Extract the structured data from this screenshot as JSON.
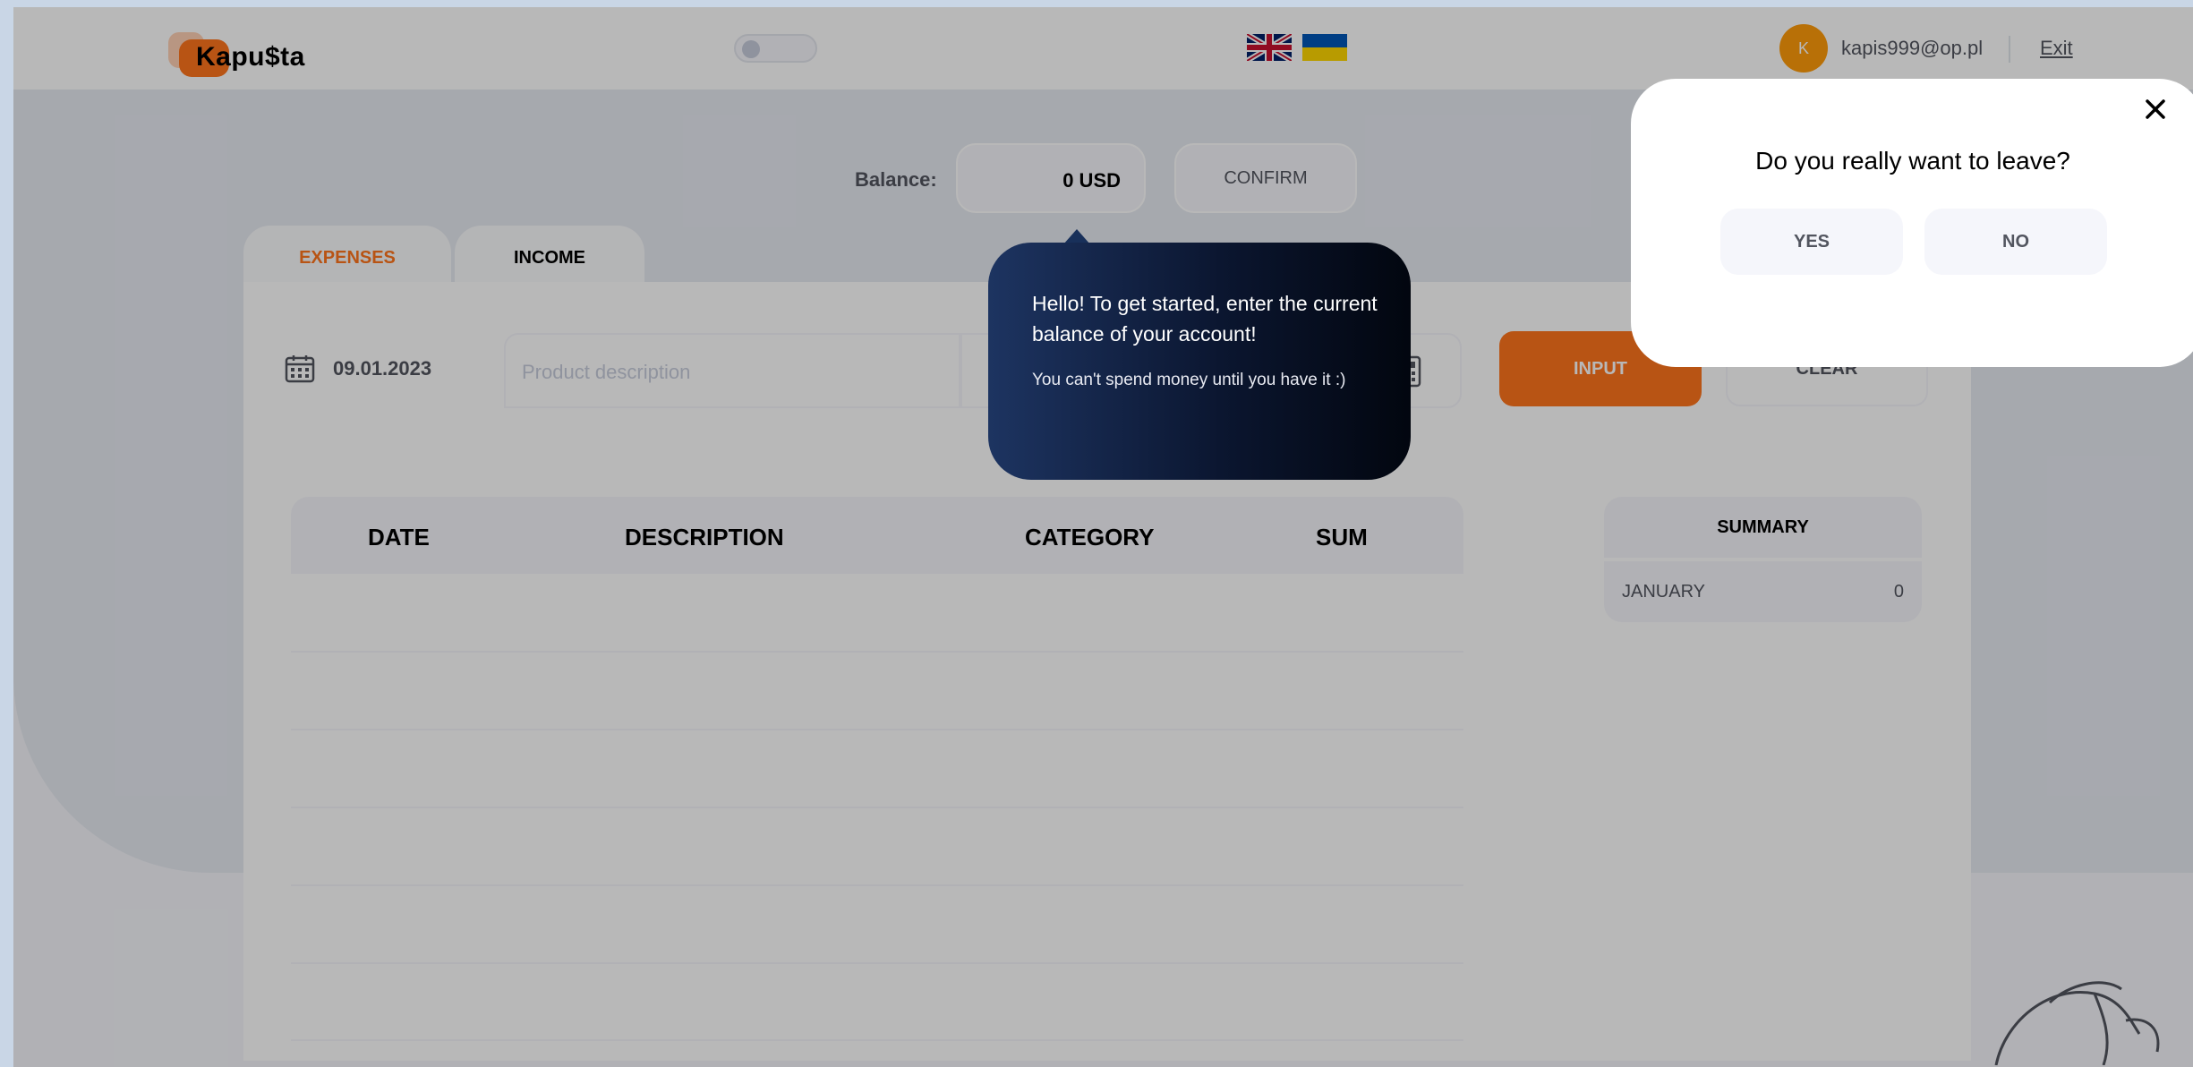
{
  "header": {
    "logo_text": "Kapu$ta",
    "user_initial": "K",
    "user_email": "kapis999@op.pl",
    "exit_label": "Exit",
    "icons": [
      "theme-toggle",
      "uk-flag-icon",
      "ukraine-flag-icon"
    ]
  },
  "balance": {
    "label": "Balance:",
    "value": "0 USD",
    "confirm_label": "CONFIRM"
  },
  "tabs": [
    {
      "label": "EXPENSES",
      "active": true
    },
    {
      "label": "INCOME",
      "active": false
    }
  ],
  "form": {
    "date": "09.01.2023",
    "description_placeholder": "Product description",
    "input_label": "INPUT",
    "clear_label": "CLEAR"
  },
  "table": {
    "columns": [
      "DATE",
      "DESCRIPTION",
      "CATEGORY",
      "SUM"
    ],
    "rows": []
  },
  "summary": {
    "title": "SUMMARY",
    "rows": [
      {
        "month": "JANUARY",
        "value": "0"
      }
    ]
  },
  "tooltip": {
    "main": "Hello! To get started, enter the current balance of your account!",
    "sub": "You can't spend money until you have it :)"
  },
  "modal": {
    "question": "Do you really want to leave?",
    "yes_label": "YES",
    "no_label": "NO"
  },
  "colors": {
    "accent": "#ff751d",
    "avatar": "#ff9b0a",
    "tooltip_dark": "#0b1630"
  }
}
